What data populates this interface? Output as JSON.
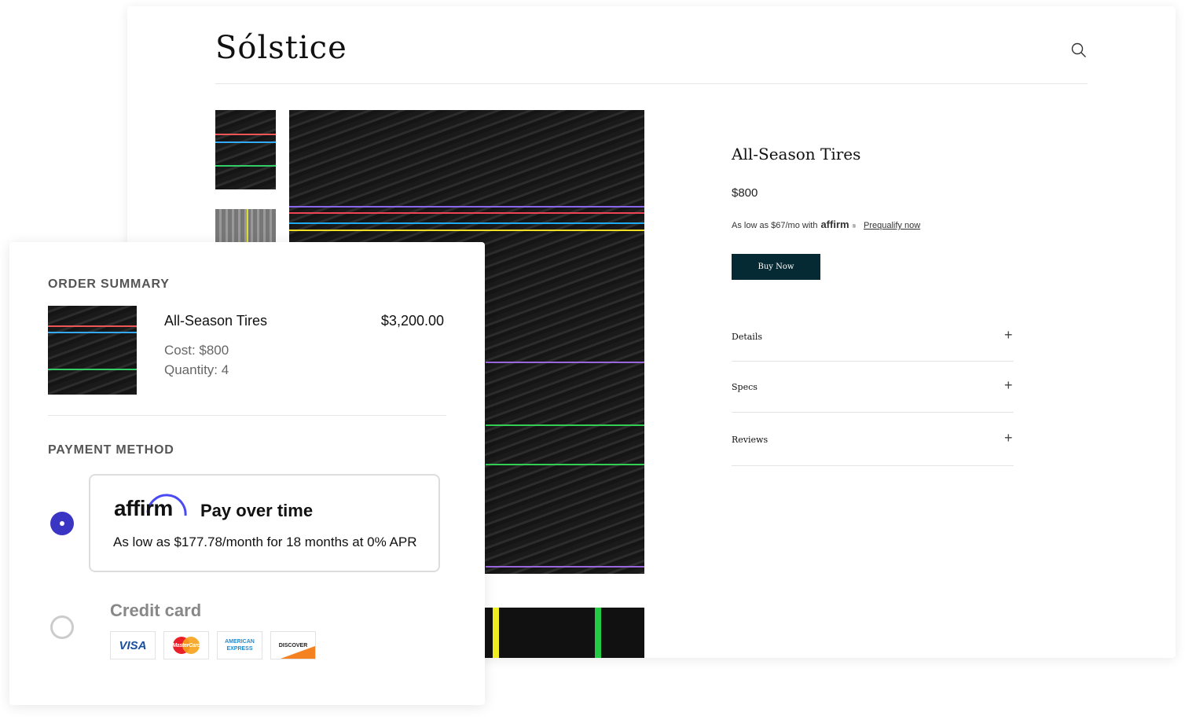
{
  "brand": {
    "logo": "Sólstice"
  },
  "product": {
    "title": "All-Season Tires",
    "price": "$800",
    "affirm_line": "As low as $67/mo with",
    "affirm_logo": "affirm",
    "prequalify": "Prequalify now",
    "buy_label": "Buy Now",
    "accordions": [
      {
        "label": "Details"
      },
      {
        "label": "Specs"
      },
      {
        "label": "Reviews"
      }
    ]
  },
  "order_summary": {
    "heading": "ORDER SUMMARY",
    "item_title": "All-Season Tires",
    "item_total": "$3,200.00",
    "cost": "Cost: $800",
    "quantity": "Quantity: 4"
  },
  "payment": {
    "heading": "PAYMENT METHOD",
    "affirm": {
      "logo": "affirm",
      "title": "Pay over time",
      "subtitle": "As low as $177.78/month for 18 months at 0% APR",
      "selected": true
    },
    "credit": {
      "title": "Credit card",
      "selected": false,
      "cards": [
        "VISA",
        "MasterCard",
        "AMERICAN EXPRESS",
        "DISCOVER"
      ]
    }
  },
  "colors": {
    "accent": "#3b35c3",
    "button": "#062a33"
  }
}
